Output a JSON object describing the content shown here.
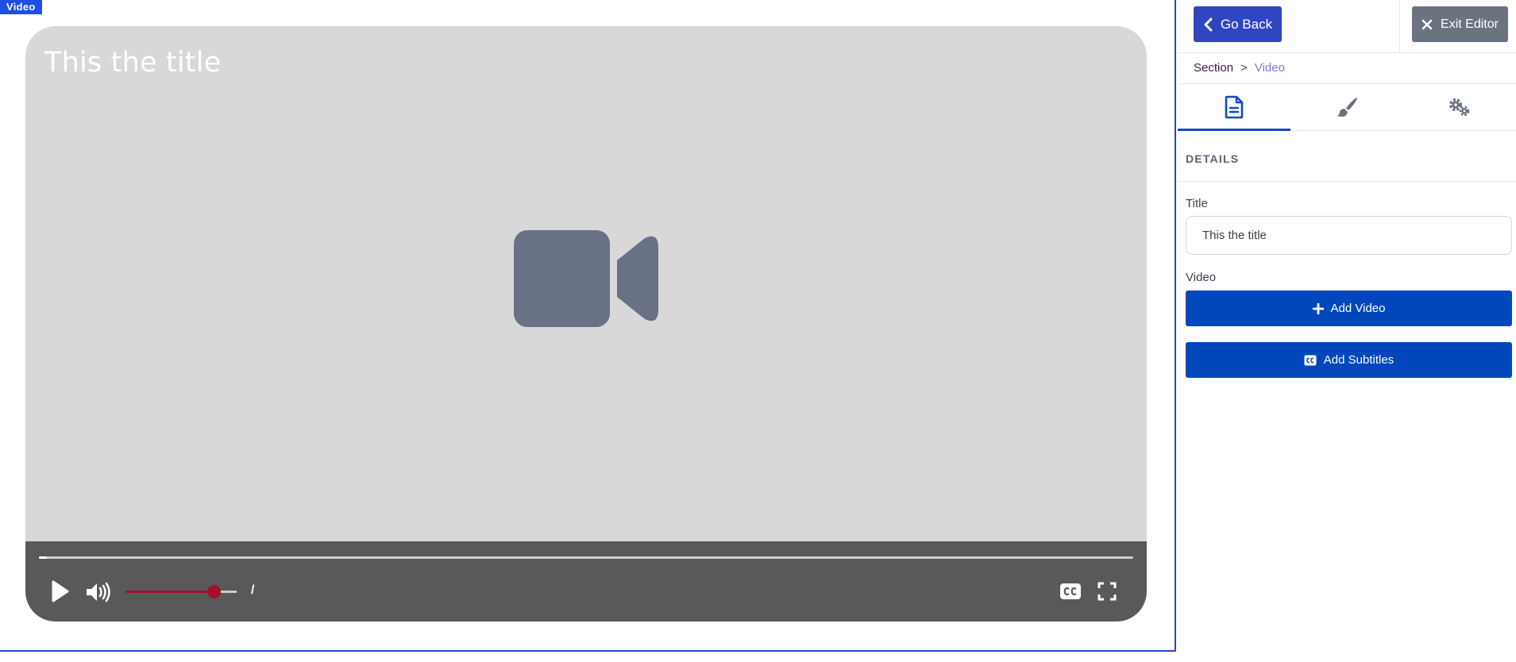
{
  "canvas": {
    "element_tag": "Video",
    "player": {
      "title": "This the title",
      "progress_percent": 0.7,
      "volume_percent": 79,
      "time_text": "/",
      "colors": {
        "volume_accent": "#a3122c",
        "controls_bg": "#595959"
      }
    }
  },
  "sidebar": {
    "go_back_label": "Go Back",
    "exit_editor_label": "Exit Editor",
    "breadcrumb": {
      "section": "Section",
      "separator": ">",
      "current": "Video"
    },
    "tabs": [
      {
        "icon": "document-icon",
        "active": true
      },
      {
        "icon": "paintbrush-icon",
        "active": false
      },
      {
        "icon": "gears-icon",
        "active": false
      }
    ],
    "details": {
      "heading": "DETAILS",
      "title_label": "Title",
      "title_value": "This the title",
      "video_label": "Video",
      "add_video_label": "Add Video",
      "add_subtitles_label": "Add Subtitles"
    },
    "colors": {
      "primary": "#0047bb",
      "go_back": "#2f45c2",
      "exit": "#6b7280"
    }
  }
}
